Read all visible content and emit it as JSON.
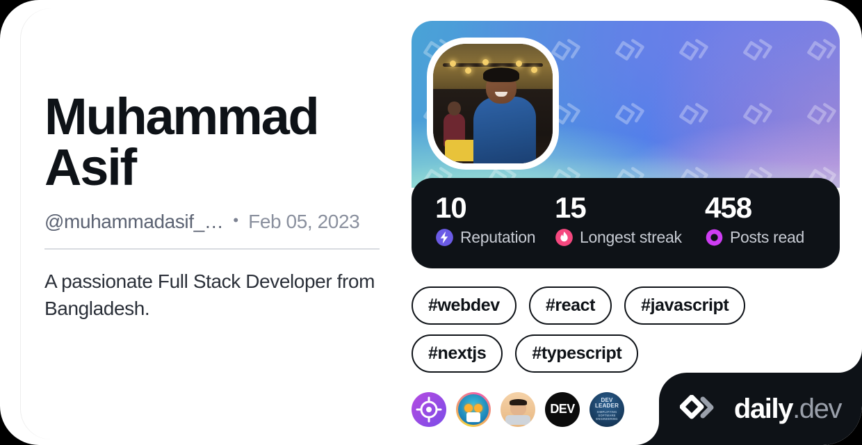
{
  "profile": {
    "name": "Muhammad Asif",
    "handle": "@muhammadasif_…",
    "meta_separator": "•",
    "joined_date": "Feb 05, 2023",
    "bio": "A passionate Full Stack Developer from Bangladesh."
  },
  "stats": [
    {
      "value": "10",
      "label": "Reputation",
      "icon": "reputation-bolt-icon",
      "color": "#6B5BE6"
    },
    {
      "value": "15",
      "label": "Longest streak",
      "icon": "streak-flame-icon",
      "color": "#F5487F"
    },
    {
      "value": "458",
      "label": "Posts read",
      "icon": "posts-read-ring-icon",
      "color": "#CE3DF3"
    }
  ],
  "tags": [
    {
      "label": "#webdev"
    },
    {
      "label": "#react"
    },
    {
      "label": "#javascript"
    },
    {
      "label": "#nextjs"
    },
    {
      "label": "#typescript"
    }
  ],
  "badges": [
    {
      "name": "badge-target",
      "title": "Target badge"
    },
    {
      "name": "badge-robot",
      "title": "Robot badge"
    },
    {
      "name": "badge-memoji",
      "title": "Memoji badge"
    },
    {
      "name": "badge-dev",
      "title": "DEV",
      "text": "DEV"
    },
    {
      "name": "badge-dev-leader",
      "title": "DEV Leader",
      "text": "DEV LEADER",
      "subtext": "Simplifying Software Engineering"
    }
  ],
  "brand": {
    "name_primary": "daily",
    "name_secondary": ".dev",
    "logo_icon": "daily-dev-chevron-logo"
  },
  "theme": {
    "card_background": "#ffffff",
    "page_background": "#000000",
    "text_primary": "#0E1217",
    "text_muted": "#8a909e",
    "dark_surface": "#0E1217"
  }
}
